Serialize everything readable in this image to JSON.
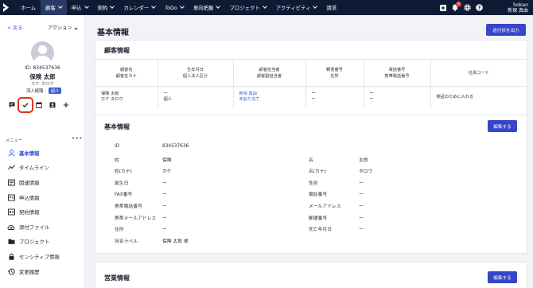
{
  "nav": {
    "items": [
      {
        "label": "ホーム",
        "chevron": false
      },
      {
        "label": "顧客",
        "chevron": true
      },
      {
        "label": "申込",
        "chevron": true
      },
      {
        "label": "契約",
        "chevron": true
      },
      {
        "label": "カレンダー",
        "chevron": true
      },
      {
        "label": "ToDo",
        "chevron": true
      },
      {
        "label": "意向把握",
        "chevron": true
      },
      {
        "label": "プロジェクト",
        "chevron": true
      },
      {
        "label": "アクティビティ",
        "chevron": true
      },
      {
        "label": "請求",
        "chevron": false
      }
    ],
    "active_index": 1,
    "notification_count": "6",
    "user_line1": "hokan",
    "user_line2": "新保 真由"
  },
  "sidebar": {
    "back_label": "< 戻る",
    "action_label": "アクション",
    "customer_id": "ID: 834537636",
    "customer_name": "保険 太郎",
    "customer_kana": "ホケ タロウ",
    "route_label": "流入経路 :",
    "route_tag": "紹介",
    "menu_label": "メニュー",
    "menu_dots": "•••",
    "menu_items": [
      {
        "label": "基本情報",
        "icon": "person-icon"
      },
      {
        "label": "タイムライン",
        "icon": "timeline-icon"
      },
      {
        "label": "関連情報",
        "icon": "related-icon"
      },
      {
        "label": "申込情報",
        "icon": "application-icon"
      },
      {
        "label": "契約情報",
        "icon": "contract-icon"
      },
      {
        "label": "添付ファイル",
        "icon": "cloud-upload-icon"
      },
      {
        "label": "プロジェクト",
        "icon": "folder-icon"
      },
      {
        "label": "センシティブ情報",
        "icon": "lock-icon"
      },
      {
        "label": "変更履歴",
        "icon": "history-icon"
      }
    ],
    "active_menu_index": 0
  },
  "main": {
    "page_title": "基本情報",
    "output_button": "送付状を出力",
    "customer_info": {
      "title": "顧客情報",
      "headers": [
        [
          "顧客名",
          "顧客名カナ"
        ],
        [
          "生年月日",
          "個人法人区分"
        ],
        [
          "顧客担当者",
          "顧客副担当者"
        ],
        [
          "郵便番号",
          "住所"
        ],
        [
          "電話番号",
          "携帯電話番号"
        ],
        [
          "社員コード"
        ]
      ],
      "row": [
        [
          "保険 太郎",
          "ホケ タロウ"
        ],
        [
          "ー",
          "個人"
        ],
        [
          "新保 真由",
          "未割り当て"
        ],
        [
          "ー",
          "ー"
        ],
        [
          "ー",
          "ー"
        ],
        [
          "検証のために入れる"
        ]
      ]
    },
    "basic_info": {
      "title": "基本情報",
      "edit_label": "編集する",
      "left_fields": [
        {
          "label": "ID",
          "value": "834537636"
        },
        {
          "label": "姓",
          "value": "保険"
        },
        {
          "label": "姓(カナ)",
          "value": "ホケ"
        },
        {
          "label": "誕生日",
          "value": "ー"
        },
        {
          "label": "FAX番号",
          "value": "ー"
        },
        {
          "label": "携帯電話番号",
          "value": "ー"
        },
        {
          "label": "携帯メールアドレス",
          "value": "ー"
        },
        {
          "label": "住所",
          "value": "ー"
        },
        {
          "label": "宛名ラベル",
          "value": "保険 太郎 様"
        }
      ],
      "right_fields": [
        {
          "label": "名",
          "value": "太郎"
        },
        {
          "label": "名(カナ)",
          "value": "タロウ"
        },
        {
          "label": "性別",
          "value": "ー"
        },
        {
          "label": "電話番号",
          "value": "ー"
        },
        {
          "label": "メールアドレス",
          "value": "ー"
        },
        {
          "label": "郵便番号",
          "value": "ー"
        },
        {
          "label": "死亡年月日",
          "value": "ー"
        }
      ]
    },
    "sales_info": {
      "title": "営業情報",
      "edit_label": "編集する"
    }
  },
  "colors": {
    "nav_bg": "#0f1b34",
    "nav_active": "#2a3a66",
    "primary": "#3546c8",
    "link": "#3a5bd9",
    "highlight": "#e0341f"
  }
}
